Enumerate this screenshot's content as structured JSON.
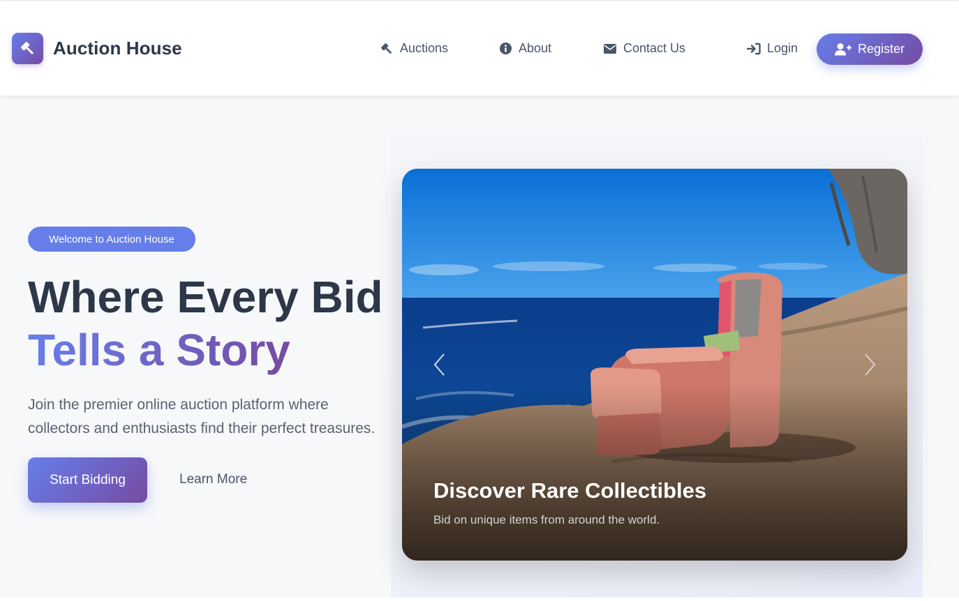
{
  "brand": {
    "name": "Auction House",
    "logo_icon": "gavel-icon"
  },
  "nav": {
    "auctions": "Auctions",
    "about": "About",
    "contact": "Contact Us",
    "login": "Login",
    "register": "Register"
  },
  "hero": {
    "badge": "Welcome to Auction House",
    "headline_line1": "Where Every Bid",
    "headline_line2": "Tells a Story",
    "lead": "Join the premier online auction platform where collectors and enthusiasts find their perfect treasures.",
    "primary_cta": "Start Bidding",
    "secondary_cta": "Learn More"
  },
  "carousel": {
    "slide_title": "Discover Rare Collectibles",
    "slide_subtitle": "Bid on unique items from around the world.",
    "prev_icon": "chevron-left-icon",
    "next_icon": "chevron-right-icon"
  },
  "colors": {
    "accent_start": "#667eea",
    "accent_end": "#764ba2",
    "text_dark": "#2d3748"
  }
}
